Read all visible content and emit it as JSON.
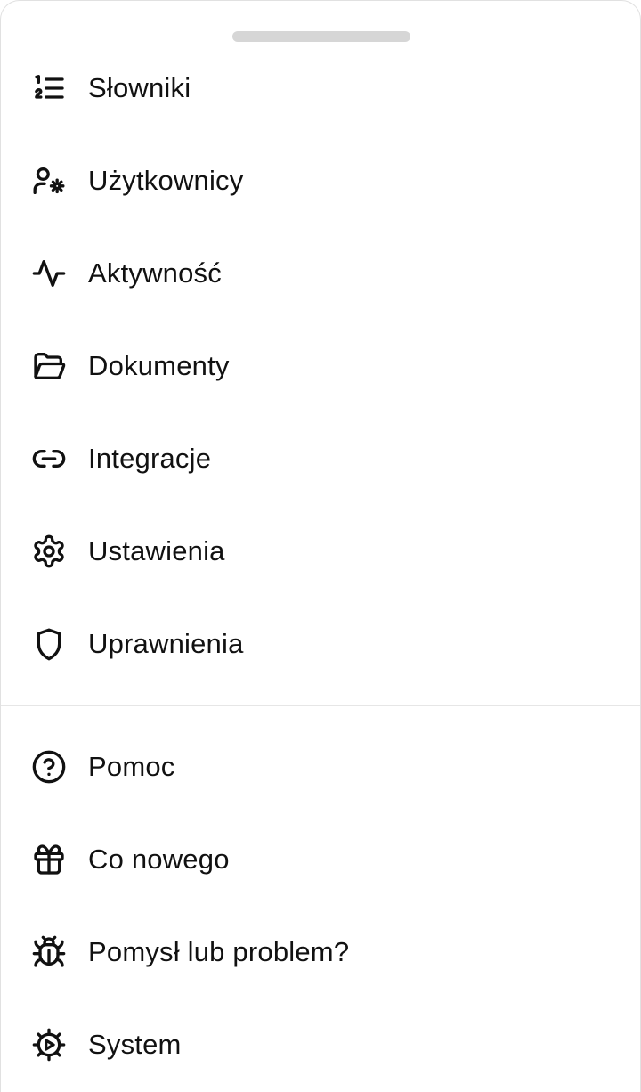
{
  "menu": {
    "primary": [
      {
        "label": "Słowniki",
        "icon": "numbered-list-icon"
      },
      {
        "label": "Użytkownicy",
        "icon": "user-settings-icon"
      },
      {
        "label": "Aktywność",
        "icon": "activity-icon"
      },
      {
        "label": "Dokumenty",
        "icon": "folder-open-icon"
      },
      {
        "label": "Integracje",
        "icon": "link-icon"
      },
      {
        "label": "Ustawienia",
        "icon": "gear-icon"
      },
      {
        "label": "Uprawnienia",
        "icon": "shield-icon"
      }
    ],
    "secondary": [
      {
        "label": "Pomoc",
        "icon": "help-circle-icon"
      },
      {
        "label": "Co nowego",
        "icon": "gift-icon"
      },
      {
        "label": "Pomysł lub problem?",
        "icon": "bug-icon"
      },
      {
        "label": "System",
        "icon": "system-cog-icon"
      }
    ]
  },
  "colors": {
    "text": "#111111",
    "handle": "#d6d6d6",
    "divider": "#e6e6e6",
    "background": "#ffffff"
  }
}
